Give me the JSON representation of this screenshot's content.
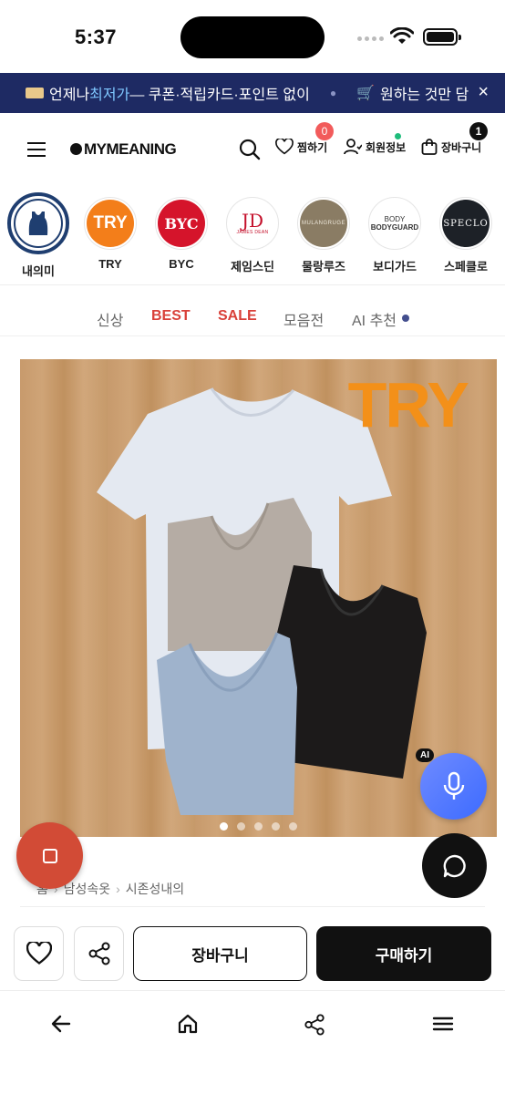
{
  "status_bar": {
    "time": "5:37"
  },
  "promo": {
    "text_pre": "언제나 ",
    "text_accent": "최저가",
    "text_post": " — 쿠폰·적립카드·포인트 없이",
    "text_next": "원하는 것만 담",
    "close_label": "×"
  },
  "header": {
    "logo": "MYMEANING",
    "wishlist_label": "찜하기",
    "wishlist_count": "0",
    "account_label": "회원정보",
    "cart_label": "장바구니",
    "cart_count": "1"
  },
  "brands": [
    {
      "name": "내의미",
      "icon": "tank-top-icon"
    },
    {
      "name": "TRY",
      "logo_text": "TRY"
    },
    {
      "name": "BYC",
      "logo_text": "BYC"
    },
    {
      "name": "제임스딘",
      "logo_text": "JD",
      "logo_sub": "JAMES DEAN"
    },
    {
      "name": "물랑루즈",
      "logo_text": "MULANGRUGE"
    },
    {
      "name": "보디가드",
      "logo_text": "BODY",
      "logo_sub": "BODYGUARD"
    },
    {
      "name": "스페클로",
      "logo_text": "SPECLO"
    }
  ],
  "tabs": [
    "신상",
    "BEST",
    "SALE",
    "모음전",
    "AI 추천"
  ],
  "product": {
    "brand_overlay": "TRY",
    "carousel_count": 5,
    "carousel_active": 0
  },
  "ai_badge": "AI",
  "breadcrumb": [
    "홈",
    "남성속옷",
    "시존성내의"
  ],
  "actions": {
    "cart_button": "장바구니",
    "buy_button": "구매하기"
  },
  "colors": {
    "promo_bg": "#1e2a63",
    "accent_red": "#d9413a",
    "try_orange": "#f39019",
    "ai_blue": "#4a74ff"
  }
}
